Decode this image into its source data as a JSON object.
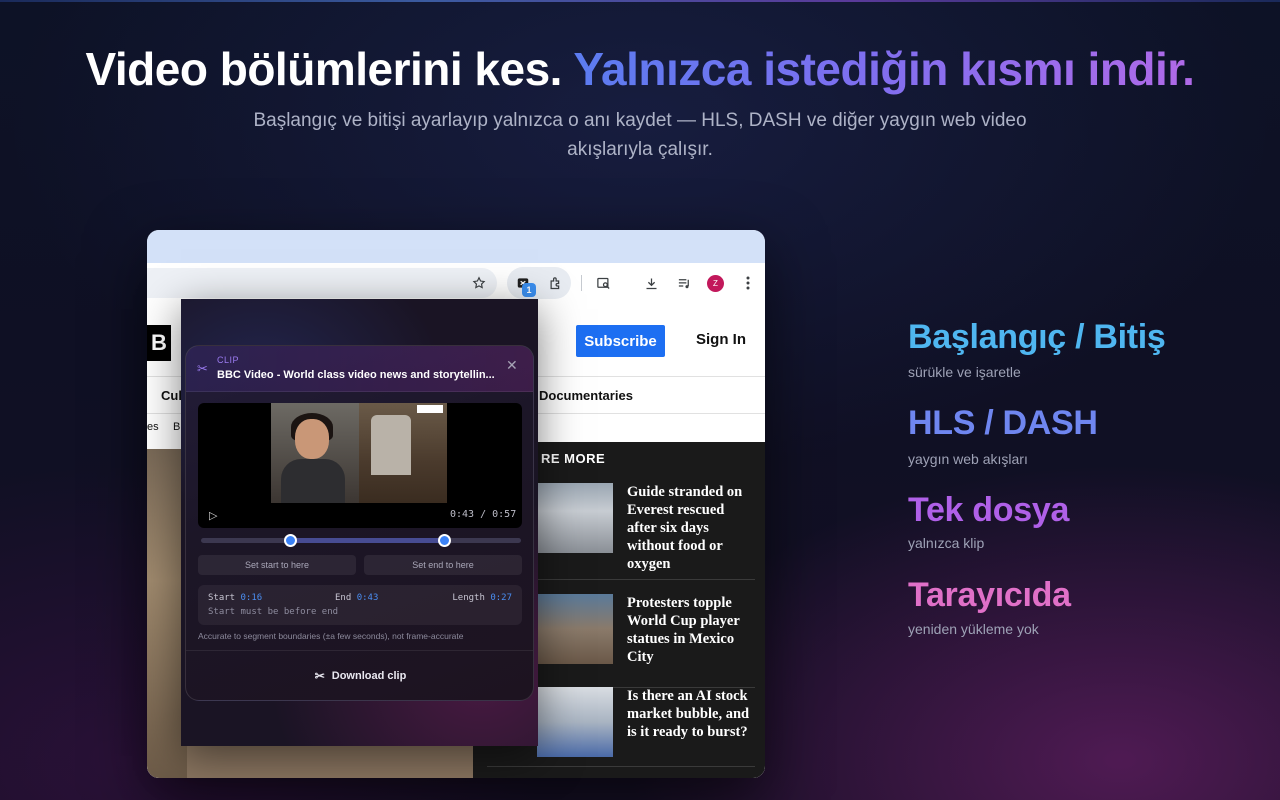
{
  "headline": {
    "part1": "Video bölümlerini kes.",
    "part2": "Yalnızca istediğin kısmı indir.",
    "accent_gradient": [
      "#5b7cf0",
      "#b06ae8"
    ]
  },
  "subhead": "Başlangıç ve bitişi ayarlayıp yalnızca o anı kaydet — HLS, DASH ve diğer yaygın web video akışlarıyla çalışır.",
  "browser": {
    "toolbar_icons": [
      "star-icon",
      "clip-extension-icon",
      "extensions-icon",
      "screenshot-search-icon",
      "download-icon",
      "media-queue-icon",
      "avatar",
      "more-icon"
    ],
    "extension_badge": "1",
    "avatar_letter": "Z"
  },
  "bbc": {
    "logo": "B",
    "subscribe": "Subscribe",
    "sign_in": "Sign In",
    "nav": [
      "Cul",
      "Documentaries"
    ],
    "subnav": [
      "es",
      "B"
    ],
    "more_title": "RE MORE",
    "stories": [
      {
        "title": "Guide stranded on Everest rescued after six days without food or oxygen"
      },
      {
        "title": "Protesters topple World Cup player statues in Mexico City"
      },
      {
        "title": "Is there an AI stock market bubble, and is it ready to burst?"
      }
    ]
  },
  "clip_popup": {
    "label": "CLIP",
    "title": "BBC Video - World class video news and storytellin...",
    "time_current": "0:43 / 0:57",
    "start_pct": 0.28,
    "end_pct": 0.76,
    "set_start": "Set start to here",
    "set_end": "Set end to here",
    "start_label": "Start",
    "start_value": "0:16",
    "end_label": "End",
    "end_value": "0:43",
    "length_label": "Length",
    "length_value": "0:27",
    "warning": "Start must be before end",
    "note": "Accurate to segment boundaries (±a few seconds), not frame-accurate",
    "download": "Download clip"
  },
  "features": [
    {
      "title": "Başlangıç / Bitiş",
      "desc": "sürükle ve işaretle",
      "color": "#4fb6f0"
    },
    {
      "title": "HLS / DASH",
      "desc": "yaygın web akışları",
      "color": "#6f86f0"
    },
    {
      "title": "Tek dosya",
      "desc": "yalnızca klip",
      "color": "#b060e8"
    },
    {
      "title": "Tarayıcıda",
      "desc": "yeniden yükleme yok",
      "color": "#e070c8"
    }
  ]
}
